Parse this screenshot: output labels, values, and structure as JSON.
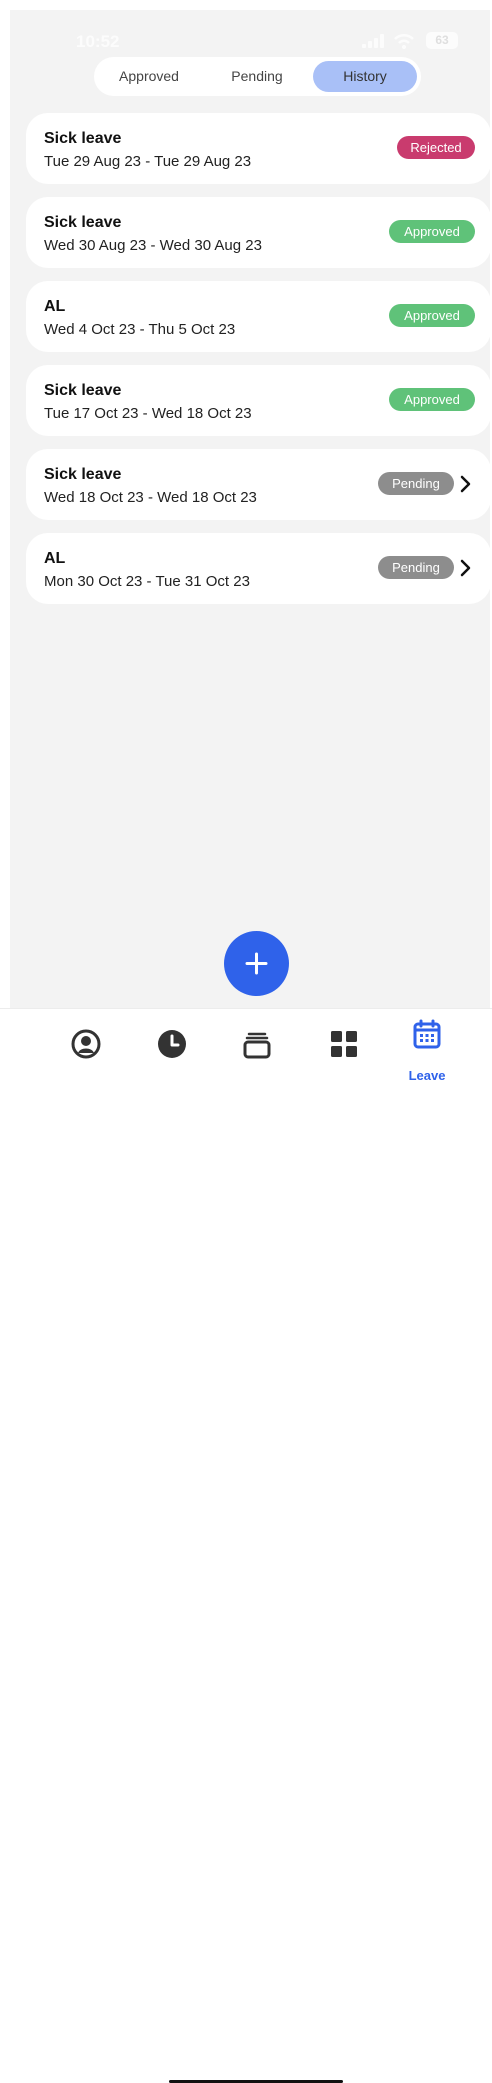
{
  "status_bar": {
    "time": "10:52",
    "battery": "63"
  },
  "tabs": [
    {
      "label": "Approved",
      "active": false
    },
    {
      "label": "Pending",
      "active": false
    },
    {
      "label": "History",
      "active": true
    }
  ],
  "leaves": [
    {
      "type": "Sick leave",
      "dates": "Tue 29 Aug 23 - Tue 29 Aug 23",
      "status": "Rejected"
    },
    {
      "type": "Sick leave",
      "dates": "Wed 30 Aug 23 - Wed 30 Aug 23",
      "status": "Approved"
    },
    {
      "type": "AL",
      "dates": "Wed 4 Oct 23 - Thu 5 Oct 23",
      "status": "Approved"
    },
    {
      "type": "Sick leave",
      "dates": "Tue 17 Oct 23 - Wed 18 Oct 23",
      "status": "Approved"
    },
    {
      "type": "Sick leave",
      "dates": "Wed 18 Oct 23 - Wed 18 Oct 23",
      "status": "Pending",
      "has_chevron": true
    },
    {
      "type": "AL",
      "dates": "Mon 30 Oct 23 - Tue 31 Oct 23",
      "status": "Pending",
      "has_chevron": true
    }
  ],
  "fab": {
    "icon": "plus-icon"
  },
  "bottom_nav": {
    "items": [
      {
        "icon": "profile-icon"
      },
      {
        "icon": "clock-icon"
      },
      {
        "icon": "stack-icon"
      },
      {
        "icon": "dashboard-icon"
      },
      {
        "icon": "calendar-icon",
        "label": "Leave",
        "active": true
      }
    ]
  },
  "colors": {
    "accent": "#2f62ea",
    "active_tab": "#a9c0f7",
    "rejected": "#c93b6e",
    "approved": "#5fc279",
    "pending": "#8d8d8d",
    "background": "#f3f3f3"
  }
}
